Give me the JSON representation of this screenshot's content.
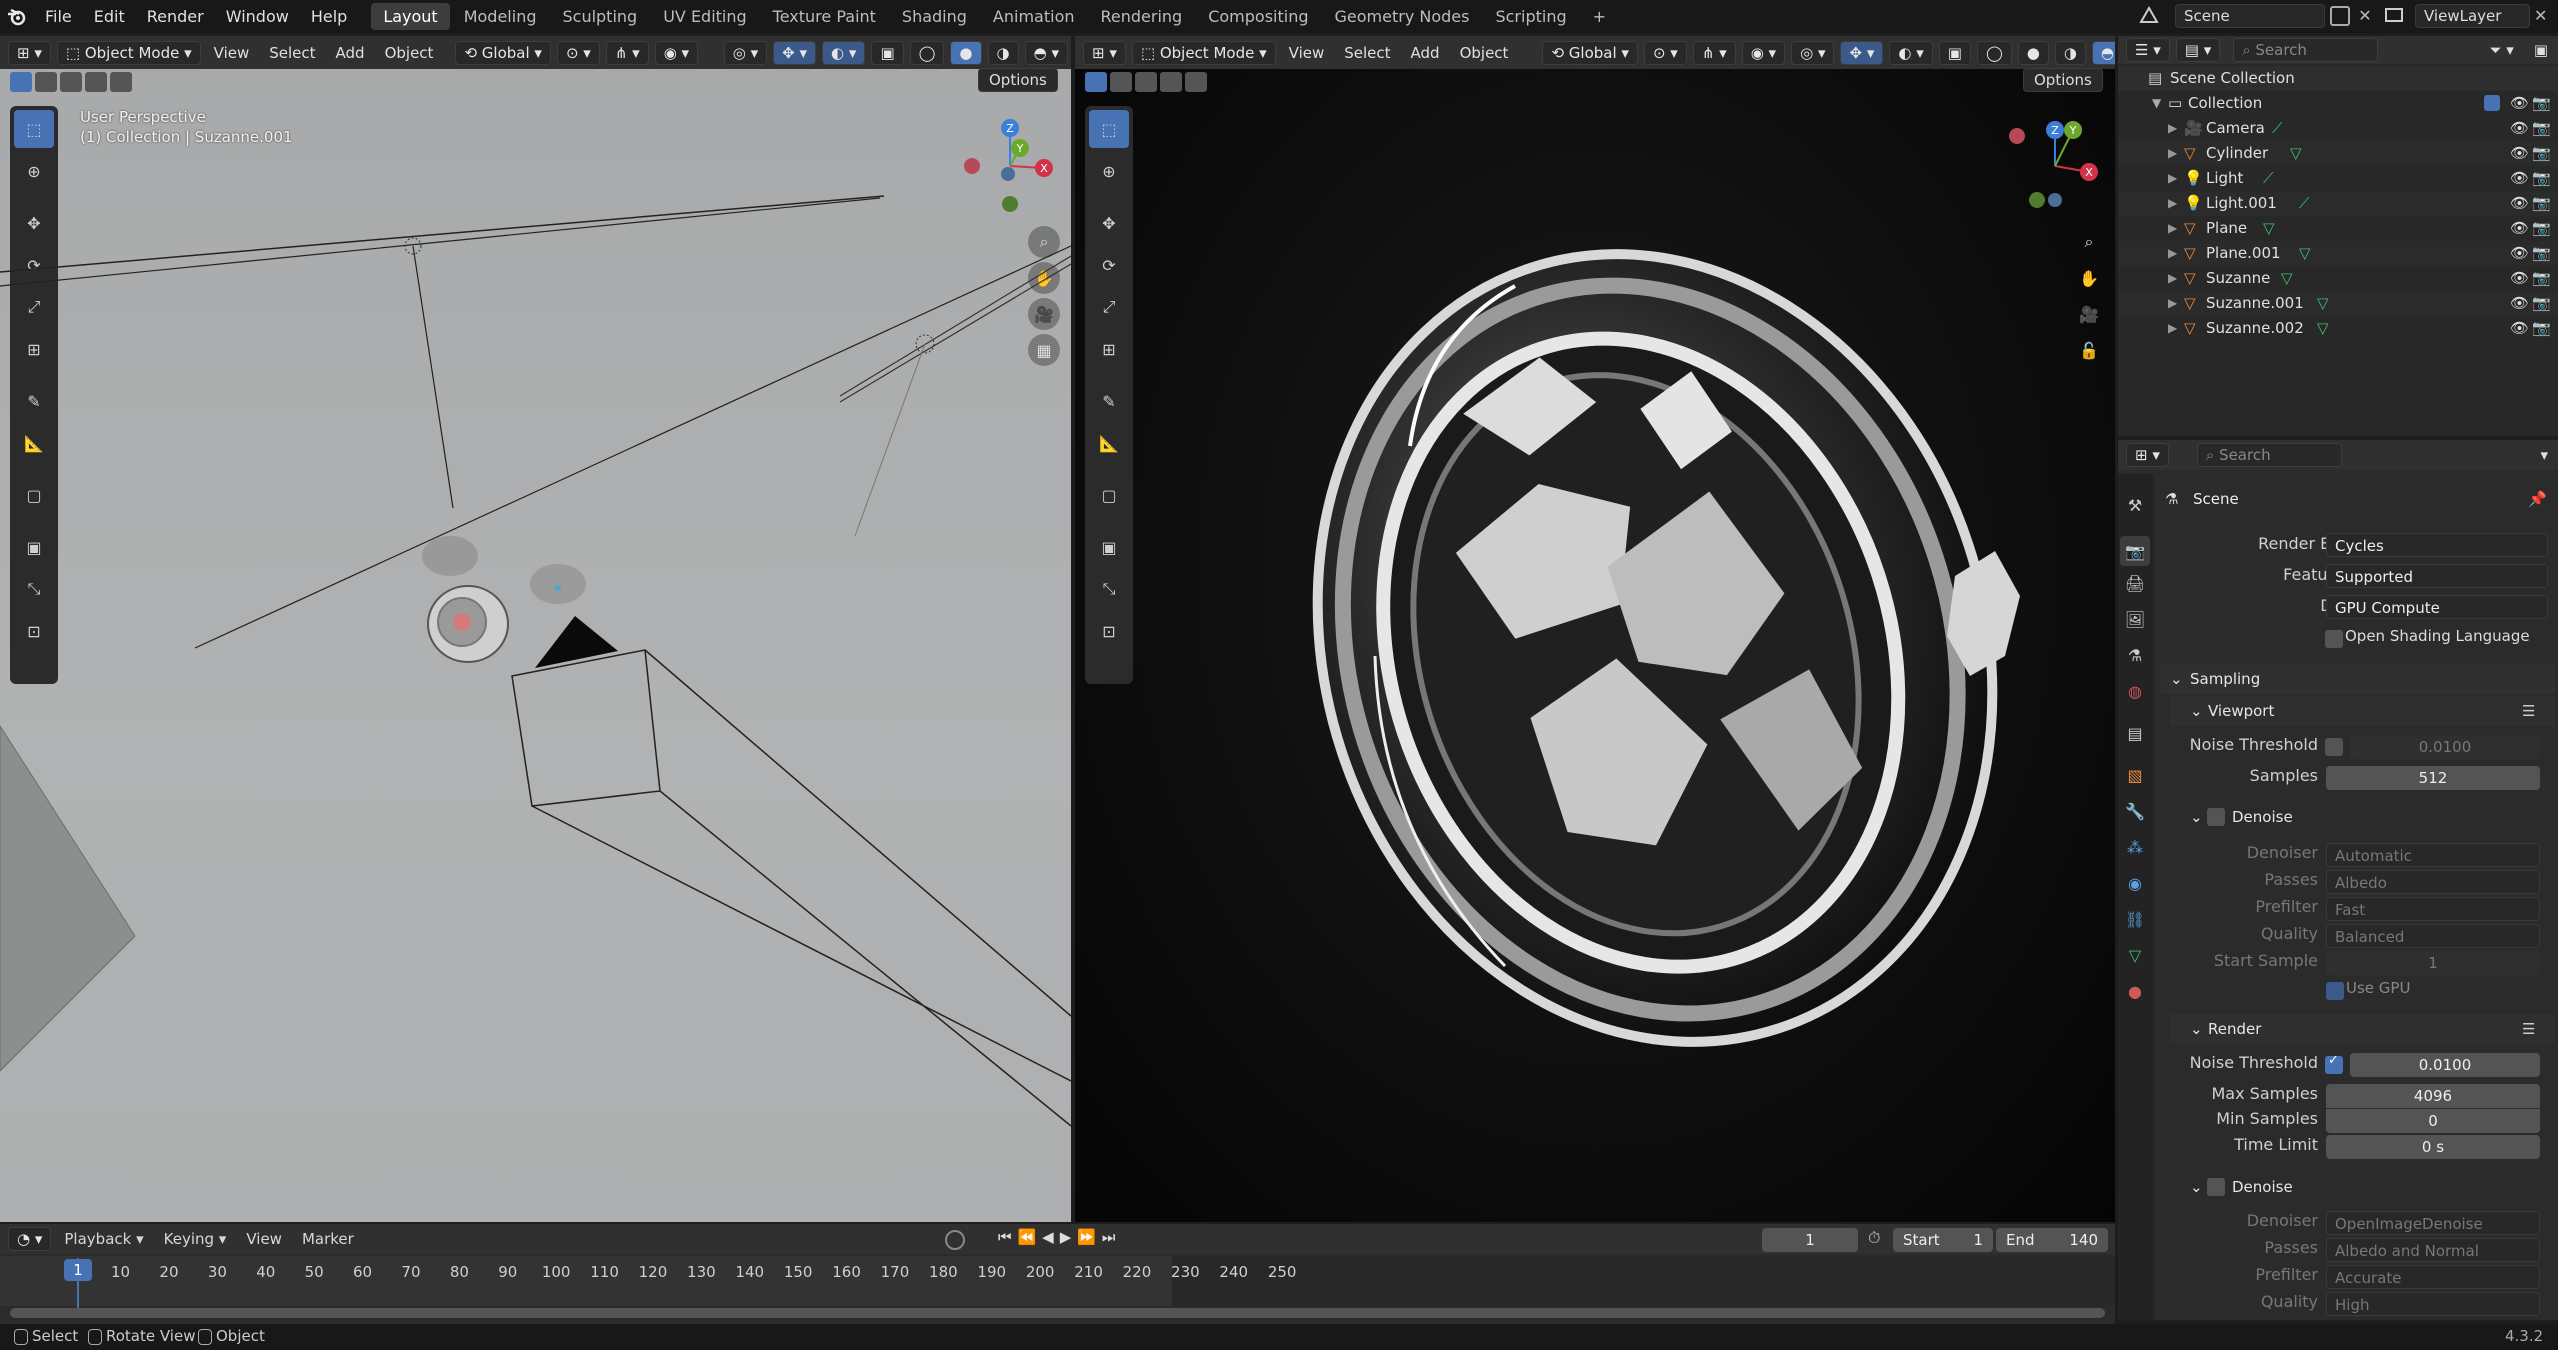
{
  "topbar": {
    "menus": [
      "File",
      "Edit",
      "Render",
      "Window",
      "Help"
    ],
    "workspaces": [
      "Layout",
      "Modeling",
      "Sculpting",
      "UV Editing",
      "Texture Paint",
      "Shading",
      "Animation",
      "Rendering",
      "Compositing",
      "Geometry Nodes",
      "Scripting"
    ],
    "active_workspace": "Layout",
    "add_label": "+",
    "scene": "Scene",
    "view_layer": "ViewLayer"
  },
  "viewport_left": {
    "mode": "Object Mode",
    "menus": [
      "View",
      "Select",
      "Add",
      "Object"
    ],
    "orientation": "Global",
    "options": "Options",
    "overlay_title": "User Perspective",
    "overlay_sub": "(1) Collection | Suzanne.001",
    "gizmo": {
      "z": "Z",
      "y": "Y",
      "x": "X"
    }
  },
  "viewport_right": {
    "mode": "Object Mode",
    "menus": [
      "View",
      "Select",
      "Add",
      "Object"
    ],
    "orientation": "Global",
    "options": "Options",
    "gizmo": {
      "z": "Z",
      "y": "Y",
      "x": "X"
    }
  },
  "outliner": {
    "search_placeholder": "Search",
    "root": "Scene Collection",
    "collection": "Collection",
    "items": [
      {
        "name": "Camera",
        "type": "camera"
      },
      {
        "name": "Cylinder",
        "type": "mesh"
      },
      {
        "name": "Light",
        "type": "light"
      },
      {
        "name": "Light.001",
        "type": "light"
      },
      {
        "name": "Plane",
        "type": "mesh"
      },
      {
        "name": "Plane.001",
        "type": "mesh"
      },
      {
        "name": "Suzanne",
        "type": "mesh"
      },
      {
        "name": "Suzanne.001",
        "type": "mesh"
      },
      {
        "name": "Suzanne.002",
        "type": "mesh"
      }
    ]
  },
  "properties": {
    "search_placeholder": "Search",
    "context": "Scene",
    "render_engine_label": "Render Engine",
    "render_engine": "Cycles",
    "feature_set_label": "Feature Set",
    "feature_set": "Supported",
    "device_label": "Device",
    "device": "GPU Compute",
    "osl_label": "Open Shading Language",
    "sampling": "Sampling",
    "viewport": "Viewport",
    "vp_noise_label": "Noise Threshold",
    "vp_noise": "0.0100",
    "vp_samples_label": "Samples",
    "vp_samples": "512",
    "vp_denoise": "Denoise",
    "vp_denoiser_label": "Denoiser",
    "vp_denoiser": "Automatic",
    "vp_passes_label": "Passes",
    "vp_passes": "Albedo",
    "vp_prefilter_label": "Prefilter",
    "vp_prefilter": "Fast",
    "vp_quality_label": "Quality",
    "vp_quality": "Balanced",
    "vp_start_label": "Start Sample",
    "vp_start": "1",
    "use_gpu_label": "Use GPU",
    "render": "Render",
    "r_noise_label": "Noise Threshold",
    "r_noise": "0.0100",
    "r_max_label": "Max Samples",
    "r_max": "4096",
    "r_min_label": "Min Samples",
    "r_min": "0",
    "r_time_label": "Time Limit",
    "r_time": "0 s",
    "r_denoise": "Denoise",
    "r_denoiser_label": "Denoiser",
    "r_denoiser": "OpenImageDenoise",
    "r_passes_label": "Passes",
    "r_passes": "Albedo and Normal",
    "r_prefilter_label": "Prefilter",
    "r_prefilter": "Accurate",
    "r_quality_label": "Quality",
    "r_quality": "High"
  },
  "timeline": {
    "menus": [
      "Playback",
      "Keying",
      "View",
      "Marker"
    ],
    "current_frame": "1",
    "start_label": "Start",
    "start": "1",
    "end_label": "End",
    "end": "140",
    "ticks": [
      "1",
      "10",
      "20",
      "30",
      "40",
      "50",
      "60",
      "70",
      "80",
      "90",
      "100",
      "110",
      "120",
      "130",
      "140",
      "150",
      "160",
      "170",
      "180",
      "190",
      "200",
      "210",
      "220",
      "230",
      "240",
      "250"
    ]
  },
  "statusbar": {
    "select": "Select",
    "rotate": "Rotate View",
    "object": "Object",
    "version": "4.3.2"
  }
}
